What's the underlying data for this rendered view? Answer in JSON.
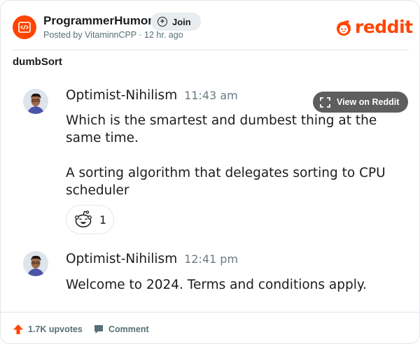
{
  "header": {
    "subreddit": "ProgrammerHumor",
    "join_label": "Join",
    "posted_by": "Posted by VitaminnCPP · 12 hr. ago",
    "logo_text": "reddit"
  },
  "post": {
    "title": "dumbSort"
  },
  "view_button_label": "View on Reddit",
  "comments": [
    {
      "author": "Optimist-Nihilism",
      "time": "11:43 am",
      "lines": [
        "Which is the smartest and dumbest thing at the same time.",
        "A sorting algorithm that delegates sorting to CPU scheduler"
      ],
      "reaction_count": "1"
    },
    {
      "author": "Optimist-Nihilism",
      "time": "12:41 pm",
      "lines": [
        "Welcome to 2024. Terms and conditions apply."
      ]
    }
  ],
  "footer": {
    "upvotes": "1.7K upvotes",
    "comment_label": "Comment"
  },
  "colors": {
    "brand": "#ff4500",
    "muted": "#576f76",
    "text": "#1c1c1c"
  }
}
